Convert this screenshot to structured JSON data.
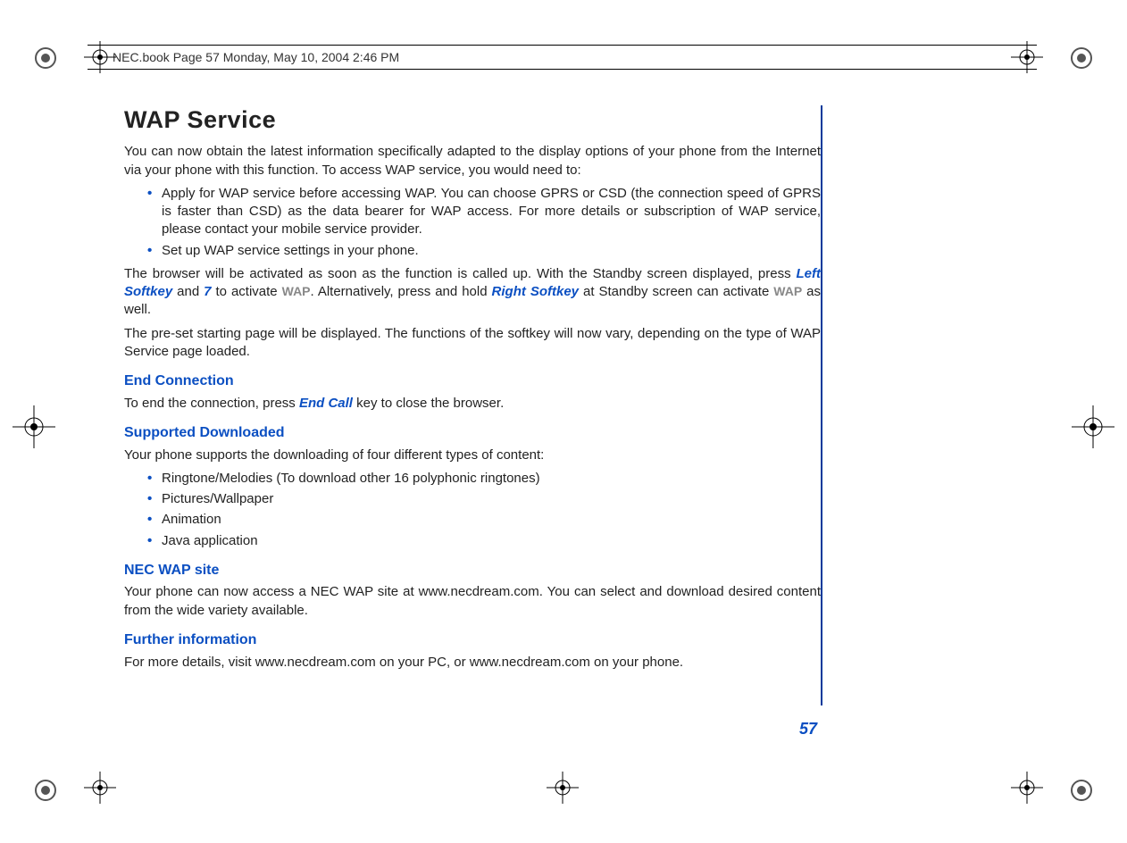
{
  "header": "NEC.book  Page 57  Monday, May 10, 2004  2:46 PM",
  "page_number": "57",
  "title": "WAP Service",
  "intro": "You can now obtain the latest information specifically adapted to the display options of your phone from the Internet via your phone with this function. To access WAP service, you would need to:",
  "intro_bullets": [
    "Apply for WAP service before accessing WAP. You can choose GPRS or CSD (the connection speed of GPRS is faster than CSD) as the data bearer for WAP access. For more details or subscription of WAP service, please contact your mobile service provider.",
    "Set up WAP service settings in your phone."
  ],
  "para2_parts": {
    "a": "The browser will be activated as soon as the function is called up. With the Standby screen displayed, press ",
    "key1": "Left Softkey",
    "b": " and ",
    "key2": "7",
    "c": " to activate ",
    "menu1": "WAP",
    "d": ". Alternatively, press and hold ",
    "key3": "Right Softkey",
    "e": " at Standby screen can activate ",
    "menu2": "WAP",
    "f": " as well."
  },
  "para3": "The pre-set starting page will be displayed. The functions of the softkey will now vary, depending on the type of WAP Service page loaded.",
  "sections": {
    "end_conn": {
      "heading": "End Connection",
      "text_a": "To end the connection, press ",
      "key": "End Call",
      "text_b": " key to close the browser."
    },
    "supported": {
      "heading": "Supported Downloaded",
      "text": "Your phone supports the downloading of four different types of content:",
      "items": [
        "Ringtone/Melodies (To download other 16 polyphonic ringtones)",
        "Pictures/Wallpaper",
        "Animation",
        "Java application"
      ]
    },
    "necwap": {
      "heading": "NEC WAP site",
      "text": "Your phone can now access a NEC WAP site at www.necdream.com. You can select and download desired content from the wide variety available."
    },
    "further": {
      "heading": "Further information",
      "text": "For more details, visit www.necdream.com on your PC, or www.necdream.com on your phone."
    }
  }
}
